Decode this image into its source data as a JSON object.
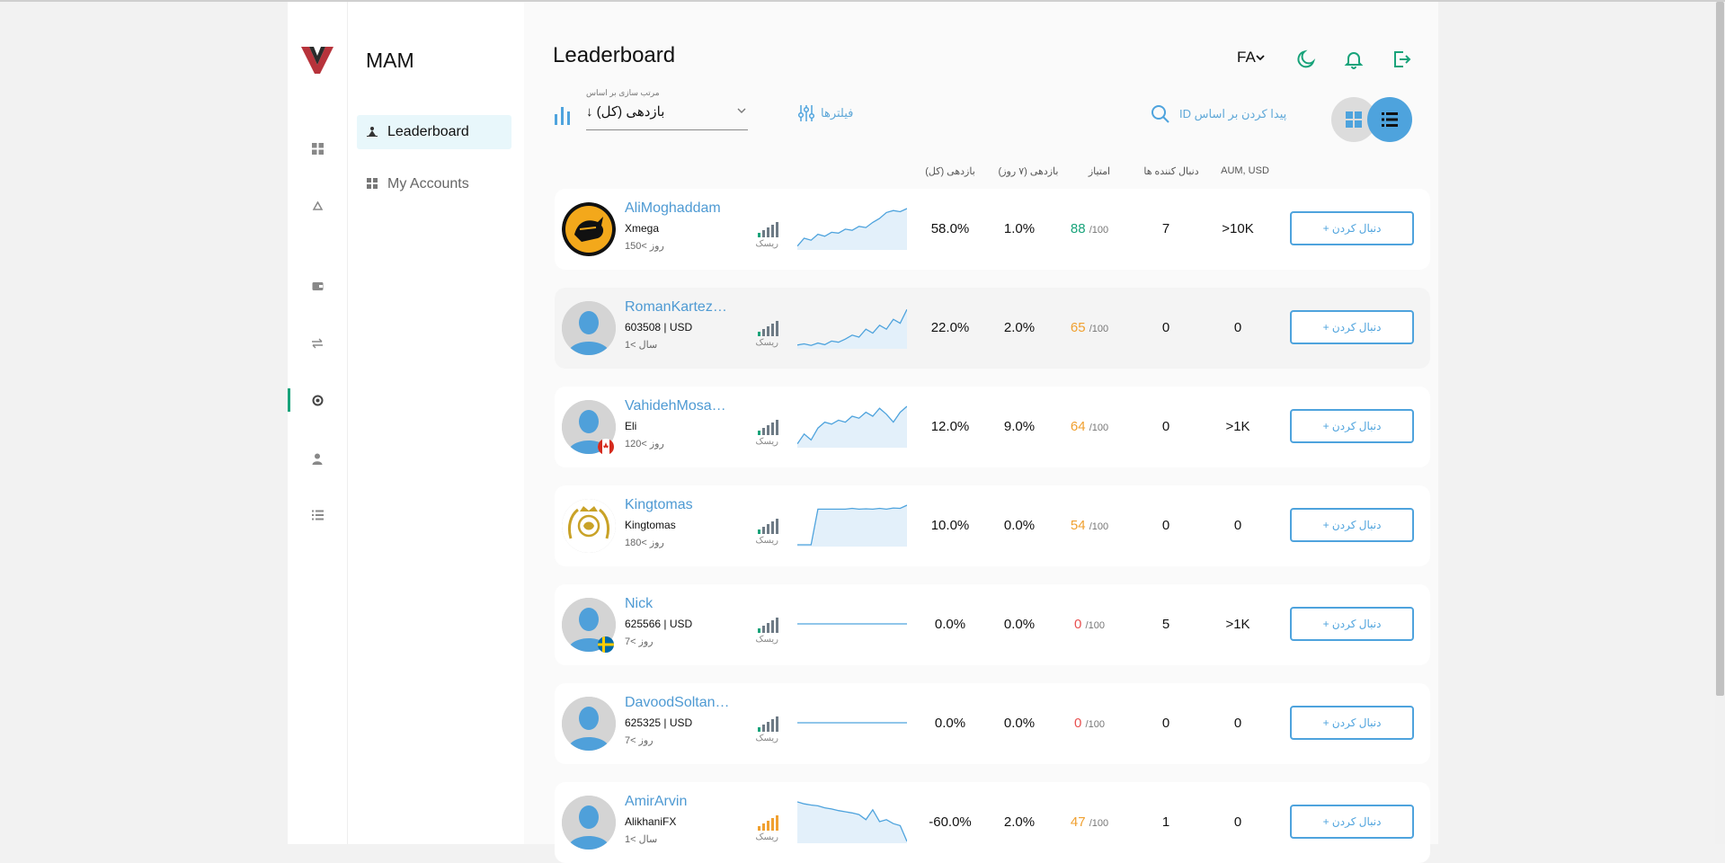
{
  "app": {
    "title": "MAM"
  },
  "brand_colors": {
    "accent": "#4ea3dd",
    "active": "#18a37a",
    "score_high": "#18a37a",
    "score_mid": "#f0a030",
    "score_low": "#e85050"
  },
  "rail_icons": [
    "dashboard-icon",
    "recycle-icon",
    "wallet-icon",
    "transfer-icon",
    "settings-icon",
    "user-icon",
    "list-icon"
  ],
  "subnav": {
    "items": [
      {
        "label": "Leaderboard",
        "icon": "trophy-icon",
        "active": true
      },
      {
        "label": "My Accounts",
        "icon": "grid-icon",
        "active": false
      }
    ]
  },
  "header": {
    "title": "Leaderboard",
    "language": "FA"
  },
  "toolbar": {
    "sort_label": "مرتب سازی بر اساس",
    "sort_value": "بازدهی (کل) ↓",
    "filters_label": "فیلترها",
    "search_placeholder": "پیدا کردن بر اساس ID"
  },
  "columns": {
    "return_total": "بازدهی (کل)",
    "return_7d": "بازدهی (۷ روز)",
    "score": "امتیاز",
    "followers": "دنبال کننده ها",
    "aum": "AUM, USD"
  },
  "risk_label": "ریسک",
  "follow_label": "دنبال کردن +",
  "rows": [
    {
      "name": "AliMoghaddam",
      "sub": "Xmega",
      "age": "روز >150",
      "ret": "58.0%",
      "ret7": "1.0%",
      "score": "88",
      "score_of": "/100",
      "score_level": "high",
      "followers": "7",
      "aum": ">10K",
      "avatar": "bull-bear-logo",
      "flag": "",
      "risk_level": 5,
      "spark": [
        0.05,
        0.25,
        0.2,
        0.35,
        0.3,
        0.4,
        0.38,
        0.48,
        0.45,
        0.55,
        0.52,
        0.65,
        0.75,
        0.9,
        0.95,
        0.92,
        1.0
      ]
    },
    {
      "name": "RomanKartez…",
      "sub": "603508 | USD",
      "age": "سال >1",
      "ret": "22.0%",
      "ret7": "2.0%",
      "score": "65",
      "score_of": "/100",
      "score_level": "mid",
      "followers": "0",
      "aum": "0",
      "avatar": "default-avatar",
      "flag": "",
      "risk_level": 5,
      "spark": [
        0.05,
        0.08,
        0.04,
        0.1,
        0.06,
        0.15,
        0.12,
        0.2,
        0.3,
        0.25,
        0.45,
        0.35,
        0.55,
        0.45,
        0.7,
        0.6,
        0.95
      ]
    },
    {
      "name": "VahidehMosa…",
      "sub": "Eli",
      "age": "روز >120",
      "ret": "12.0%",
      "ret7": "9.0%",
      "score": "64",
      "score_of": "/100",
      "score_level": "mid",
      "followers": "0",
      "aum": ">1K",
      "avatar": "default-avatar",
      "flag": "canada-flag",
      "risk_level": 5,
      "spark": [
        0.05,
        0.3,
        0.15,
        0.45,
        0.6,
        0.55,
        0.65,
        0.6,
        0.75,
        0.7,
        0.85,
        0.75,
        0.95,
        0.8,
        0.6,
        0.85,
        1.0
      ]
    },
    {
      "name": "Kingtomas",
      "sub": "Kingtomas",
      "age": "روز >180",
      "ret": "10.0%",
      "ret7": "0.0%",
      "score": "54",
      "score_of": "/100",
      "score_level": "mid",
      "followers": "0",
      "aum": "0",
      "avatar": "lion-crest-logo",
      "flag": "",
      "risk_level": 5,
      "spark": [
        0.0,
        0.0,
        0.0,
        0.9,
        0.9,
        0.9,
        0.9,
        0.9,
        0.92,
        0.9,
        0.91,
        0.9,
        0.92,
        0.9,
        0.93,
        0.92,
        1.0
      ]
    },
    {
      "name": "Nick",
      "sub": "625566 | USD",
      "age": "روز >7",
      "ret": "0.0%",
      "ret7": "0.0%",
      "score": "0",
      "score_of": "/100",
      "score_level": "low",
      "followers": "5",
      "aum": ">1K",
      "avatar": "default-avatar",
      "flag": "sweden-flag",
      "risk_level": 5,
      "spark": [
        0.5,
        0.5,
        0.5,
        0.5,
        0.5,
        0.5,
        0.5,
        0.5,
        0.5,
        0.5,
        0.5,
        0.5,
        0.5,
        0.5,
        0.5,
        0.5,
        0.5
      ]
    },
    {
      "name": "DavoodSoltani…",
      "sub": "625325 | USD",
      "age": "روز >7",
      "ret": "0.0%",
      "ret7": "0.0%",
      "score": "0",
      "score_of": "/100",
      "score_level": "low",
      "followers": "0",
      "aum": "0",
      "avatar": "default-avatar",
      "flag": "",
      "risk_level": 5,
      "spark": [
        0.5,
        0.5,
        0.5,
        0.5,
        0.5,
        0.5,
        0.5,
        0.5,
        0.5,
        0.5,
        0.5,
        0.5,
        0.5,
        0.5,
        0.5,
        0.5,
        0.5
      ]
    },
    {
      "name": "AmirArvin",
      "sub": "AlikhaniFX",
      "age": "سال >1",
      "ret": "-60.0%",
      "ret7": "2.0%",
      "score": "47",
      "score_of": "/100",
      "score_level": "mid",
      "followers": "1",
      "aum": "0",
      "avatar": "default-avatar",
      "flag": "",
      "risk_level": 6,
      "spark": [
        1.0,
        0.95,
        0.92,
        0.9,
        0.85,
        0.82,
        0.78,
        0.75,
        0.72,
        0.68,
        0.55,
        0.8,
        0.5,
        0.55,
        0.45,
        0.4,
        0.0
      ]
    }
  ]
}
